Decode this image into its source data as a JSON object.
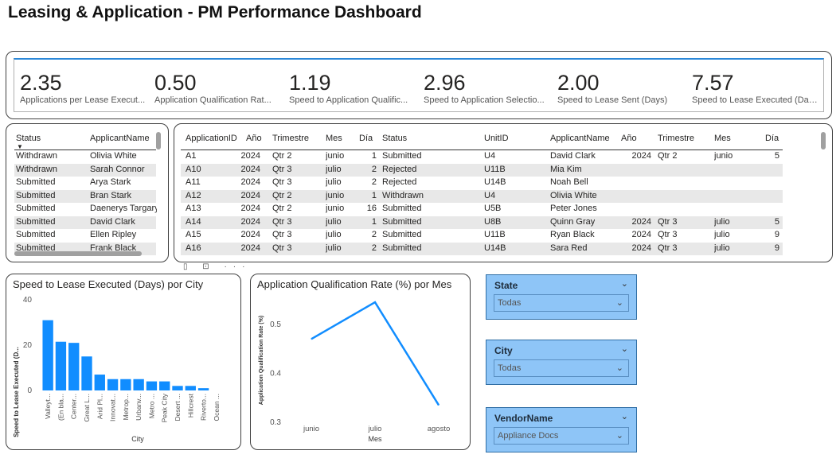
{
  "title": "Leasing & Application - PM Performance Dashboard",
  "kpis": [
    {
      "value": "2.35",
      "label": "Applications per Lease Execut..."
    },
    {
      "value": "0.50",
      "label": "Application Qualification Rat..."
    },
    {
      "value": "1.19",
      "label": "Speed to Application Qualific..."
    },
    {
      "value": "2.96",
      "label": "Speed to Application Selectio..."
    },
    {
      "value": "2.00",
      "label": "Speed to Lease Sent (Days)"
    },
    {
      "value": "7.57",
      "label": "Speed to Lease Executed (Days)"
    }
  ],
  "small_table": {
    "headers": [
      "Status",
      "ApplicantName"
    ],
    "rows": [
      [
        "Withdrawn",
        "Olivia White"
      ],
      [
        "Withdrawn",
        "Sarah Connor"
      ],
      [
        "Submitted",
        "Arya Stark"
      ],
      [
        "Submitted",
        "Bran Stark"
      ],
      [
        "Submitted",
        "Daenerys Targary"
      ],
      [
        "Submitted",
        "David Clark"
      ],
      [
        "Submitted",
        "Ellen Ripley"
      ],
      [
        "Submitted",
        "Frank Black"
      ]
    ]
  },
  "big_table": {
    "headers": [
      "ApplicationID",
      "Año",
      "Trimestre",
      "Mes",
      "Día",
      "Status",
      "UnitID",
      "ApplicantName",
      "Año",
      "Trimestre",
      "Mes",
      "Día"
    ],
    "rows": [
      [
        "A1",
        "2024",
        "Qtr 2",
        "junio",
        "1",
        "Submitted",
        "U4",
        "David Clark",
        "2024",
        "Qtr 2",
        "junio",
        "5"
      ],
      [
        "A10",
        "2024",
        "Qtr 3",
        "julio",
        "2",
        "Rejected",
        "U11B",
        "Mia Kim",
        "",
        "",
        "",
        ""
      ],
      [
        "A11",
        "2024",
        "Qtr 3",
        "julio",
        "2",
        "Rejected",
        "U14B",
        "Noah Bell",
        "",
        "",
        "",
        ""
      ],
      [
        "A12",
        "2024",
        "Qtr 2",
        "junio",
        "1",
        "Withdrawn",
        "U4",
        "Olivia White",
        "",
        "",
        "",
        ""
      ],
      [
        "A13",
        "2024",
        "Qtr 2",
        "junio",
        "16",
        "Submitted",
        "U5B",
        "Peter Jones",
        "",
        "",
        "",
        ""
      ],
      [
        "A14",
        "2024",
        "Qtr 3",
        "julio",
        "1",
        "Submitted",
        "U8B",
        "Quinn Gray",
        "2024",
        "Qtr 3",
        "julio",
        "5"
      ],
      [
        "A15",
        "2024",
        "Qtr 3",
        "julio",
        "2",
        "Submitted",
        "U11B",
        "Ryan Black",
        "2024",
        "Qtr 3",
        "julio",
        "9"
      ],
      [
        "A16",
        "2024",
        "Qtr 3",
        "julio",
        "2",
        "Submitted",
        "U14B",
        "Sara Red",
        "2024",
        "Qtr 3",
        "julio",
        "9"
      ]
    ]
  },
  "chart_data": [
    {
      "type": "bar",
      "title": "Speed to Lease Executed (Days) por City",
      "xlabel": "City",
      "ylabel": "Speed to Lease Executed (D...",
      "categories": [
        "Valleyt...",
        "(En bla...",
        "Center...",
        "Great L...",
        "Arid Pl...",
        "Innovat...",
        "Metrop...",
        "Urbanv...",
        "Metro ...",
        "Peak City",
        "Desert ...",
        "Hillcrest",
        "Riverto...",
        "Ocean ..."
      ],
      "values": [
        31,
        21.5,
        21,
        15,
        7,
        5,
        5,
        5,
        4,
        4,
        2,
        2,
        1,
        0
      ],
      "ylim": [
        0,
        40
      ],
      "yticks": [
        "0",
        "20",
        "40"
      ],
      "color": "#118dff"
    },
    {
      "type": "line",
      "title": "Application Qualification Rate (%) por Mes",
      "xlabel": "Mes",
      "ylabel": "Application Qualification Rate (%)",
      "categories": [
        "junio",
        "julio",
        "agosto"
      ],
      "values": [
        0.47,
        0.545,
        0.335
      ],
      "ylim": [
        0.3,
        0.55
      ],
      "yticks": [
        "0.3",
        "0.4",
        "0.5"
      ],
      "color": "#118dff"
    }
  ],
  "slicers": [
    {
      "title": "State",
      "value": "Todas"
    },
    {
      "title": "City",
      "value": "Todas"
    },
    {
      "title": "VendorName",
      "value": "Appliance Docs"
    }
  ],
  "icons": {
    "chevron": "chevron-down-icon",
    "sort": "sort-desc-icon"
  }
}
